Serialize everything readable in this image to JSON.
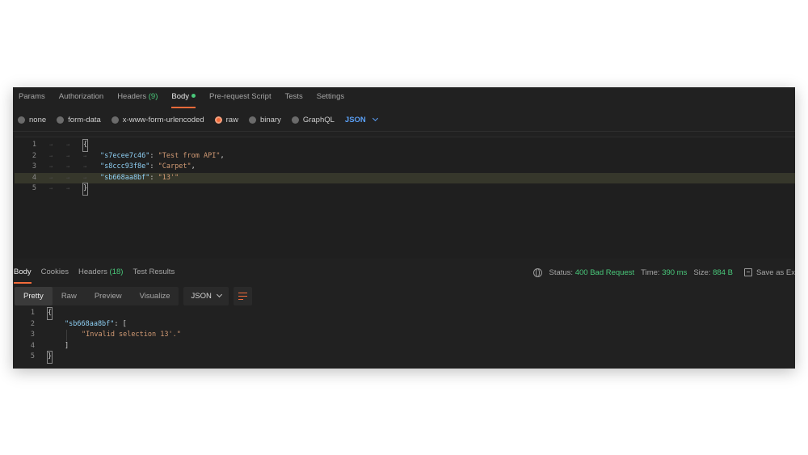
{
  "request_tabs": [
    {
      "label": "Params"
    },
    {
      "label": "Authorization"
    },
    {
      "label": "Headers",
      "count": "(9)"
    },
    {
      "label": "Body",
      "active": true
    },
    {
      "label": "Pre-request Script"
    },
    {
      "label": "Tests"
    },
    {
      "label": "Settings"
    }
  ],
  "body_types": {
    "none": "none",
    "form_data": "form-data",
    "urlencoded": "x-www-form-urlencoded",
    "raw": "raw",
    "binary": "binary",
    "graphql": "GraphQL",
    "format": "JSON"
  },
  "request_code": {
    "line_numbers": [
      "1",
      "2",
      "3",
      "4",
      "5"
    ],
    "open": "{",
    "close": "}",
    "pairs": [
      {
        "key": "\"s7ecee7c46\"",
        "sep": ": ",
        "value": "\"Test from API\"",
        "end": ","
      },
      {
        "key": "\"s8ccc93f8e\"",
        "sep": ": ",
        "value": "\"Carpet\"",
        "end": ","
      },
      {
        "key": "\"sb668aa8bf\"",
        "sep": ": ",
        "value": "\"13'\"",
        "end": ""
      }
    ]
  },
  "response_tabs": [
    {
      "label": "Body",
      "active": true
    },
    {
      "label": "Cookies"
    },
    {
      "label": "Headers",
      "count": "(18)"
    },
    {
      "label": "Test Results"
    }
  ],
  "status": {
    "status_label": "Status:",
    "status_value": "400 Bad Request",
    "time_label": "Time:",
    "time_value": "390 ms",
    "size_label": "Size:",
    "size_value": "884 B",
    "save_label": "Save as Ex"
  },
  "colors": {
    "accent": "#f26b3a",
    "status_green": "#49c87a",
    "link_blue": "#5a9ff5"
  },
  "view_modes": {
    "pretty": "Pretty",
    "raw": "Raw",
    "preview": "Preview",
    "visualize": "Visualize",
    "format": "JSON"
  },
  "response_code": {
    "line_numbers": [
      "1",
      "2",
      "3",
      "4",
      "5"
    ],
    "open": "{",
    "key": "\"sb668aa8bf\"",
    "sep": ": ",
    "arr_open": "[",
    "message": "\"Invalid selection 13'.\"",
    "arr_close": "]",
    "close": "}"
  }
}
